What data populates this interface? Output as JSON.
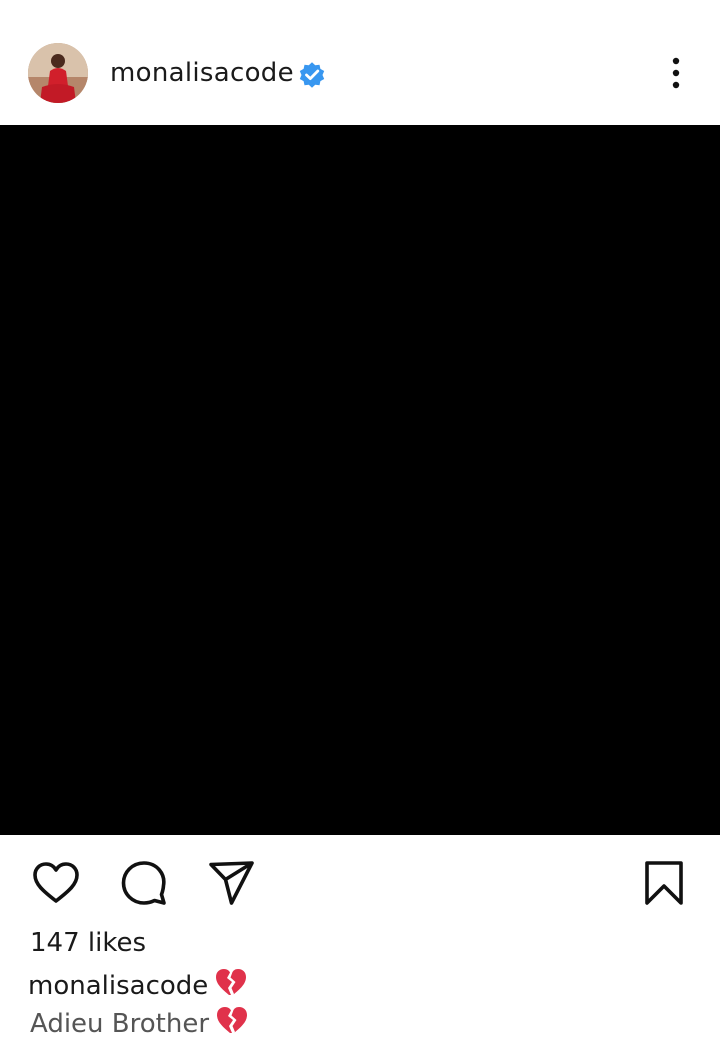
{
  "post": {
    "username": "monalisacode",
    "verified": true,
    "likes": "147 likes",
    "caption_username": "monalisacode",
    "caption_emoji": "💔",
    "caption_text": "Adieu Brother",
    "caption_text_emoji": "💔"
  },
  "icons": {
    "avatar": "profile-avatar",
    "verified": "verified-badge-icon",
    "more": "more-options-icon",
    "like": "heart-icon",
    "comment": "comment-bubble-icon",
    "share": "send-paper-plane-icon",
    "save": "bookmark-icon"
  },
  "colors": {
    "verified_blue": "#3897f0",
    "media_background": "#000000",
    "broken_heart": "#e0324b"
  }
}
